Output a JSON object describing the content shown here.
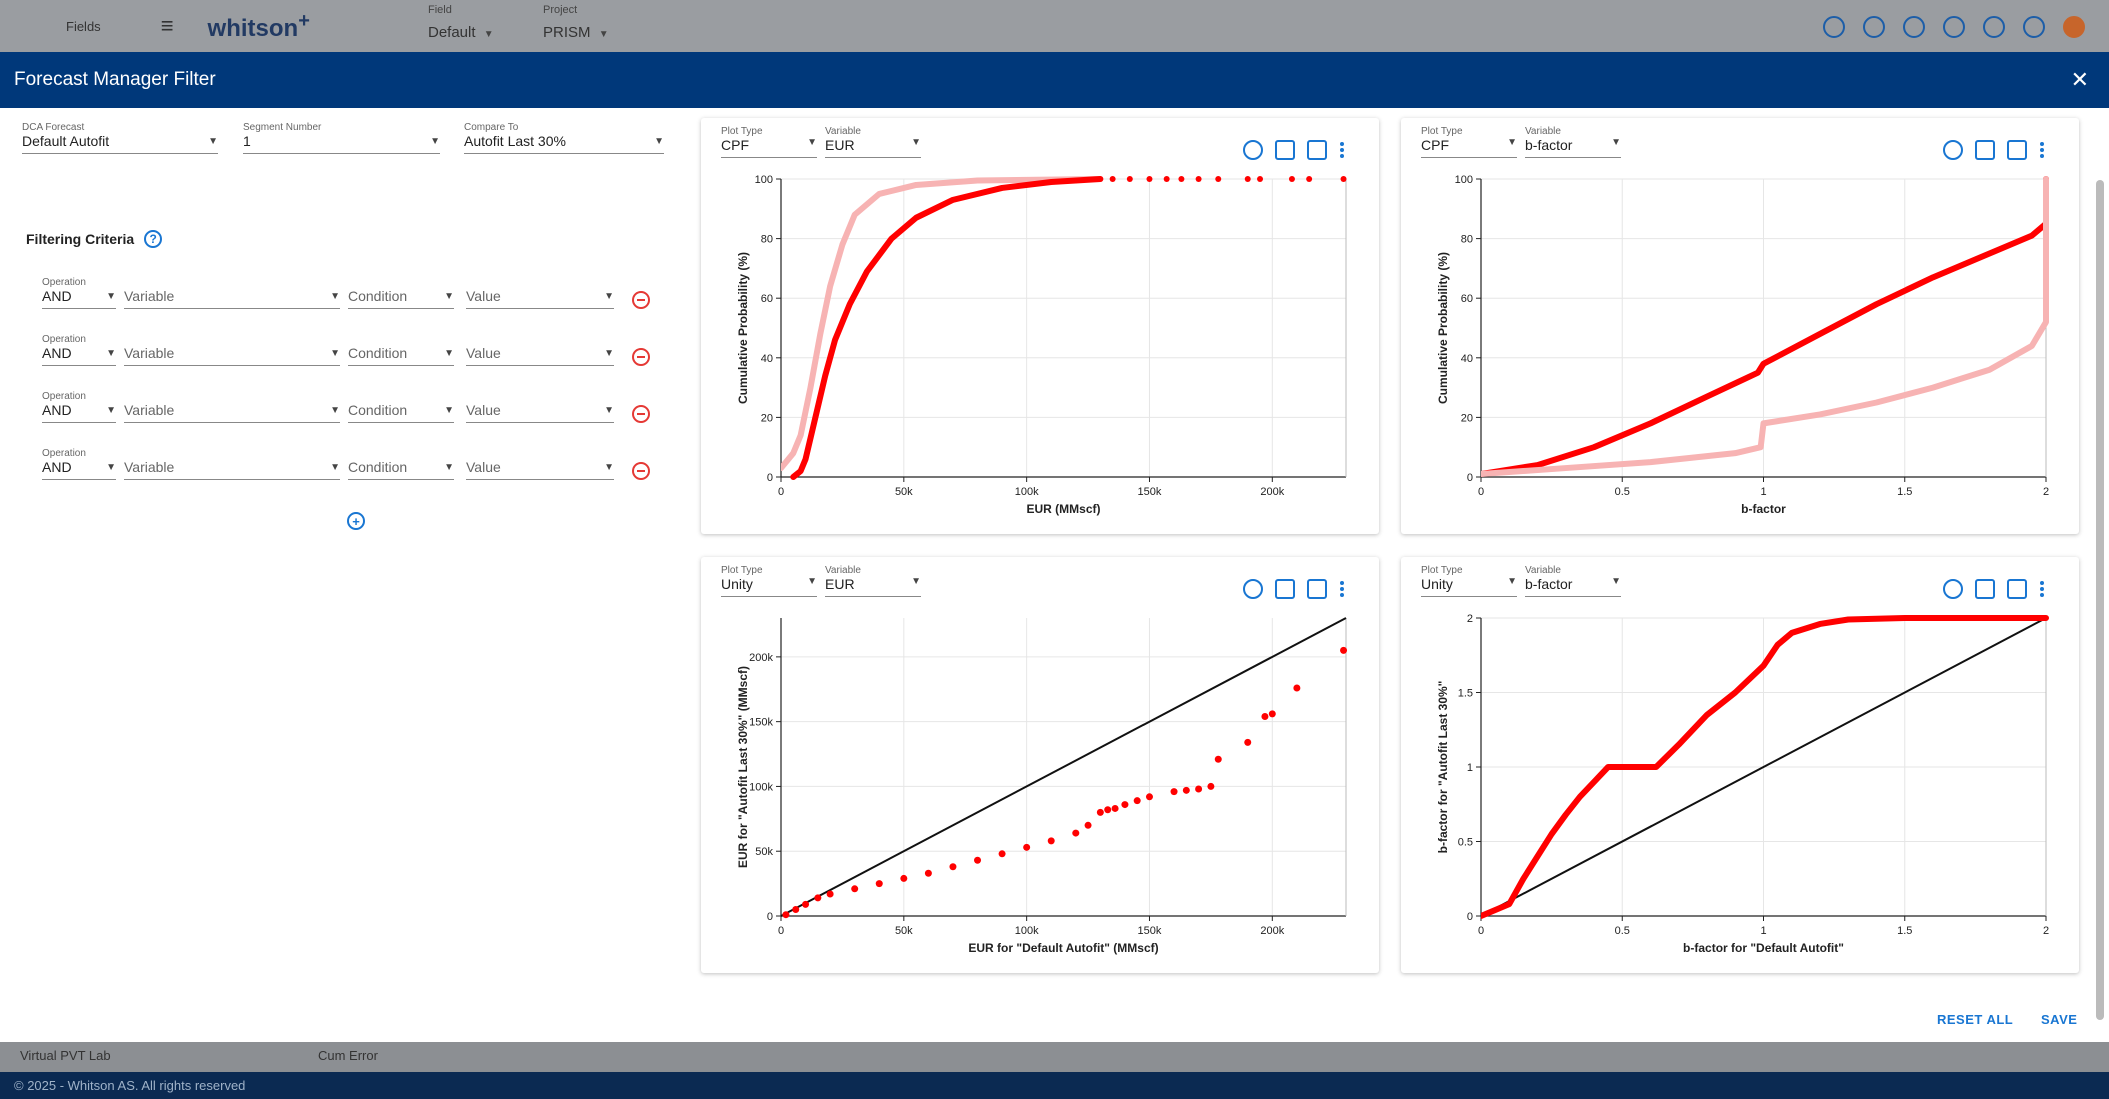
{
  "app": {
    "fields_label": "Fields",
    "brand": "whitson",
    "brand_plus": "+",
    "field_label": "Field",
    "field_value": "Default",
    "project_label": "Project",
    "project_value": "PRISM",
    "bottom_left": "Virtual PVT Lab",
    "bottom_check": "Cum Error",
    "footer": "© 2025 - Whitson AS. All rights reserved",
    "avatar_color": "#c7652b"
  },
  "modal": {
    "title": "Forecast Manager Filter",
    "close": "✕",
    "dca_forecast": {
      "label": "DCA Forecast",
      "value": "Default Autofit"
    },
    "segment_number": {
      "label": "Segment Number",
      "value": "1"
    },
    "compare_to": {
      "label": "Compare To",
      "value": "Autofit Last 30%"
    },
    "filtering_title": "Filtering Criteria",
    "criteria_labels": {
      "operation": "Operation",
      "variable": "Variable",
      "condition": "Condition",
      "value": "Value"
    },
    "criteria": [
      {
        "operation": "AND",
        "variable": "Variable",
        "condition": "Condition",
        "value": "Value"
      },
      {
        "operation": "AND",
        "variable": "Variable",
        "condition": "Condition",
        "value": "Value"
      },
      {
        "operation": "AND",
        "variable": "Variable",
        "condition": "Condition",
        "value": "Value"
      },
      {
        "operation": "AND",
        "variable": "Variable",
        "condition": "Condition",
        "value": "Value"
      }
    ],
    "reset_all": "RESET ALL",
    "save": "SAVE"
  },
  "chart_labels": {
    "plot_type": "Plot Type",
    "variable": "Variable"
  },
  "chart_data": [
    {
      "type": "line",
      "plot_type": "CPF",
      "variable": "EUR",
      "xlabel": "EUR (MMscf)",
      "ylabel": "Cumulative Probability (%)",
      "xlim": [
        0,
        230000
      ],
      "ylim": [
        0,
        100
      ],
      "xticks": [
        "0",
        "50k",
        "100k",
        "150k",
        "200k"
      ],
      "yticks": [
        "0",
        "20",
        "40",
        "60",
        "80",
        "100"
      ],
      "series": [
        {
          "color": "#f7b3b3",
          "x": [
            0,
            5000,
            8000,
            12000,
            16000,
            20000,
            25000,
            30000,
            40000,
            55000,
            80000,
            130000
          ],
          "y": [
            3,
            8,
            14,
            30,
            48,
            64,
            78,
            88,
            95,
            98,
            99.5,
            100
          ]
        },
        {
          "color": "#ff0000",
          "x": [
            5000,
            8000,
            10000,
            14000,
            18000,
            22000,
            28000,
            35000,
            45000,
            55000,
            70000,
            90000,
            110000,
            130000
          ],
          "y": [
            0,
            2,
            6,
            20,
            34,
            46,
            58,
            69,
            80,
            87,
            93,
            97,
            99,
            100
          ]
        },
        {
          "color": "#ff0000",
          "x": [
            135000,
            142000,
            150000,
            157000,
            163000,
            170000,
            178000,
            190000,
            195000,
            208000,
            215000,
            229000
          ],
          "y": [
            100,
            100,
            100,
            100,
            100,
            100,
            100,
            100,
            100,
            100,
            100,
            100
          ]
        }
      ]
    },
    {
      "type": "line",
      "plot_type": "CPF",
      "variable": "b-factor",
      "xlabel": "b-factor",
      "ylabel": "Cumulative Probability (%)",
      "xlim": [
        0,
        2
      ],
      "ylim": [
        0,
        100
      ],
      "xticks": [
        "0",
        "0.5",
        "1",
        "1.5",
        "2"
      ],
      "yticks": [
        "0",
        "20",
        "40",
        "60",
        "80",
        "100"
      ],
      "series": [
        {
          "color": "#ff0000",
          "x": [
            0,
            0.2,
            0.4,
            0.6,
            0.8,
            0.98,
            1.0,
            1.2,
            1.4,
            1.6,
            1.8,
            1.95,
            2.0,
            2.0
          ],
          "y": [
            1,
            4,
            10,
            18,
            27,
            35,
            38,
            48,
            58,
            67,
            75,
            81,
            85,
            100
          ]
        },
        {
          "color": "#f7b3b3",
          "x": [
            0,
            0.3,
            0.6,
            0.9,
            0.99,
            1.0,
            1.2,
            1.4,
            1.6,
            1.8,
            1.95,
            2.0,
            2.0
          ],
          "y": [
            1,
            3,
            5,
            8,
            10,
            18,
            21,
            25,
            30,
            36,
            44,
            52,
            100
          ]
        }
      ]
    },
    {
      "type": "scatter",
      "plot_type": "Unity",
      "variable": "EUR",
      "xlabel": "EUR for \"Default Autofit\" (MMscf)",
      "ylabel": "EUR for \"Autofit Last 30%\" (MMscf)",
      "xlim": [
        0,
        230000
      ],
      "ylim": [
        0,
        230000
      ],
      "xticks": [
        "0",
        "50k",
        "100k",
        "150k",
        "200k"
      ],
      "yticks": [
        "0",
        "50k",
        "100k",
        "150k",
        "200k"
      ],
      "unity_line": true,
      "x": [
        2000,
        6000,
        10000,
        15000,
        20000,
        30000,
        40000,
        50000,
        60000,
        70000,
        80000,
        90000,
        100000,
        110000,
        120000,
        125000,
        130000,
        133000,
        136000,
        140000,
        145000,
        150000,
        160000,
        165000,
        170000,
        175000,
        178000,
        190000,
        197000,
        200000,
        210000,
        229000
      ],
      "y": [
        1000,
        5000,
        9000,
        14000,
        17000,
        21000,
        25000,
        29000,
        33000,
        38000,
        43000,
        48000,
        53000,
        58000,
        64000,
        70000,
        80000,
        82000,
        83000,
        86000,
        89000,
        92000,
        96000,
        97000,
        98000,
        100000,
        121000,
        134000,
        154000,
        156000,
        176000,
        205000
      ]
    },
    {
      "type": "line",
      "plot_type": "Unity",
      "variable": "b-factor",
      "xlabel": "b-factor for \"Default Autofit\"",
      "ylabel": "b-factor for \"Autofit Last 30%\"",
      "xlim": [
        0,
        2
      ],
      "ylim": [
        0,
        2
      ],
      "xticks": [
        "0",
        "0.5",
        "1",
        "1.5",
        "2"
      ],
      "yticks": [
        "0",
        "0.5",
        "1",
        "1.5",
        "2"
      ],
      "unity_line": true,
      "series": [
        {
          "color": "#ff0000",
          "x": [
            0,
            0.1,
            0.15,
            0.2,
            0.25,
            0.3,
            0.35,
            0.4,
            0.45,
            0.5,
            0.6,
            0.62,
            0.7,
            0.8,
            0.9,
            1.0,
            1.05,
            1.1,
            1.2,
            1.3,
            1.5,
            2.0
          ],
          "y": [
            0,
            0.08,
            0.25,
            0.4,
            0.55,
            0.68,
            0.8,
            0.9,
            1.0,
            1.0,
            1.0,
            1.0,
            1.15,
            1.35,
            1.5,
            1.68,
            1.82,
            1.9,
            1.96,
            1.99,
            2.0,
            2.0
          ]
        }
      ]
    }
  ]
}
